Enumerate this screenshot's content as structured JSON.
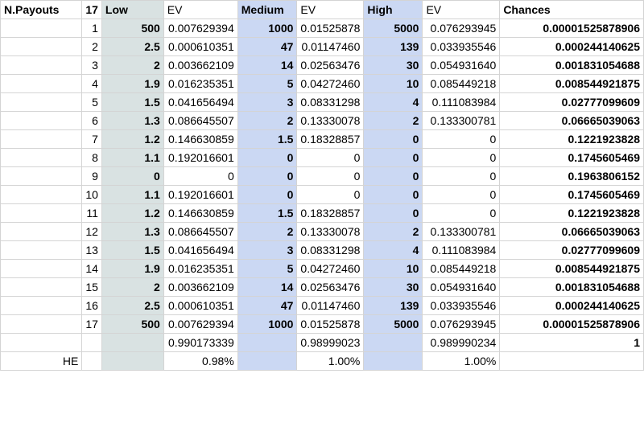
{
  "header": [
    "N.Payouts",
    "17",
    "Low",
    "EV",
    "Medium",
    "EV",
    "High",
    "EV",
    "Chances"
  ],
  "rows": [
    [
      "1",
      "500",
      "0.007629394",
      "1000",
      "0.01525878",
      "5000",
      "0.076293945",
      "0.00001525878906"
    ],
    [
      "2",
      "2.5",
      "0.000610351",
      "47",
      "0.01147460",
      "139",
      "0.033935546",
      "0.000244140625"
    ],
    [
      "3",
      "2",
      "0.003662109",
      "14",
      "0.02563476",
      "30",
      "0.054931640",
      "0.001831054688"
    ],
    [
      "4",
      "1.9",
      "0.016235351",
      "5",
      "0.04272460",
      "10",
      "0.085449218",
      "0.008544921875"
    ],
    [
      "5",
      "1.5",
      "0.041656494",
      "3",
      "0.08331298",
      "4",
      "0.111083984",
      "0.02777099609"
    ],
    [
      "6",
      "1.3",
      "0.086645507",
      "2",
      "0.13330078",
      "2",
      "0.133300781",
      "0.06665039063"
    ],
    [
      "7",
      "1.2",
      "0.146630859",
      "1.5",
      "0.18328857",
      "0",
      "0",
      "0.1221923828"
    ],
    [
      "8",
      "1.1",
      "0.192016601",
      "0",
      "0",
      "0",
      "0",
      "0.1745605469"
    ],
    [
      "9",
      "0",
      "0",
      "0",
      "0",
      "0",
      "0",
      "0.1963806152"
    ],
    [
      "10",
      "1.1",
      "0.192016601",
      "0",
      "0",
      "0",
      "0",
      "0.1745605469"
    ],
    [
      "11",
      "1.2",
      "0.146630859",
      "1.5",
      "0.18328857",
      "0",
      "0",
      "0.1221923828"
    ],
    [
      "12",
      "1.3",
      "0.086645507",
      "2",
      "0.13330078",
      "2",
      "0.133300781",
      "0.06665039063"
    ],
    [
      "13",
      "1.5",
      "0.041656494",
      "3",
      "0.08331298",
      "4",
      "0.111083984",
      "0.02777099609"
    ],
    [
      "14",
      "1.9",
      "0.016235351",
      "5",
      "0.04272460",
      "10",
      "0.085449218",
      "0.008544921875"
    ],
    [
      "15",
      "2",
      "0.003662109",
      "14",
      "0.02563476",
      "30",
      "0.054931640",
      "0.001831054688"
    ],
    [
      "16",
      "2.5",
      "0.000610351",
      "47",
      "0.01147460",
      "139",
      "0.033935546",
      "0.000244140625"
    ],
    [
      "17",
      "500",
      "0.007629394",
      "1000",
      "0.01525878",
      "5000",
      "0.076293945",
      "0.00001525878906"
    ]
  ],
  "totals": [
    "",
    "",
    "",
    "0.990173339",
    "",
    "0.98999023",
    "",
    "0.989990234",
    "1"
  ],
  "house_edge": [
    "HE",
    "",
    "",
    "0.98%",
    "",
    "1.00%",
    "",
    "1.00%",
    ""
  ],
  "colors": {
    "low_fill": "#d9e2e2",
    "medium_fill": "#cbd8f3",
    "high_fill": "#cbd8f3",
    "grid": "#d4d4d4"
  }
}
